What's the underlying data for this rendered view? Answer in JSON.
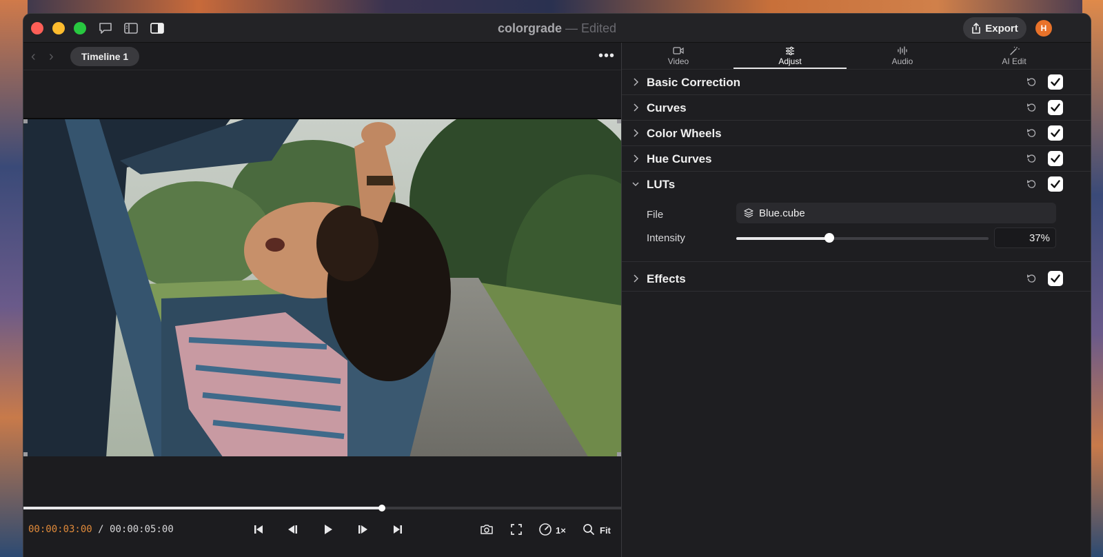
{
  "window": {
    "title": "colorgrade",
    "separator": "—",
    "status": "Edited"
  },
  "toolbar": {
    "export_label": "Export",
    "avatar_initial": "H"
  },
  "timeline": {
    "tab_label": "Timeline 1"
  },
  "playback": {
    "current_time": "00:00:03:00",
    "divider": "/",
    "duration": "00:00:05:00",
    "progress": 0.6,
    "speed_label": "1×",
    "zoom_label": "Fit"
  },
  "panel": {
    "tabs": [
      {
        "label": "Video",
        "icon": "video-icon",
        "active": false
      },
      {
        "label": "Adjust",
        "icon": "sliders-icon",
        "active": true
      },
      {
        "label": "Audio",
        "icon": "waveform-icon",
        "active": false
      },
      {
        "label": "AI Edit",
        "icon": "magic-wand-icon",
        "active": false
      }
    ],
    "sections": [
      {
        "title": "Basic Correction",
        "expanded": false,
        "enabled": true
      },
      {
        "title": "Curves",
        "expanded": false,
        "enabled": true
      },
      {
        "title": "Color Wheels",
        "expanded": false,
        "enabled": true
      },
      {
        "title": "Hue Curves",
        "expanded": false,
        "enabled": true
      },
      {
        "title": "LUTs",
        "expanded": true,
        "enabled": true
      },
      {
        "title": "Effects",
        "expanded": false,
        "enabled": true
      }
    ],
    "luts": {
      "file_label": "File",
      "file_value": "Blue.cube",
      "intensity_label": "Intensity",
      "intensity_value": "37%",
      "intensity_fraction": 0.37
    }
  },
  "colors": {
    "accent_timecode": "#e08a3a",
    "avatar": "#e8722a"
  }
}
